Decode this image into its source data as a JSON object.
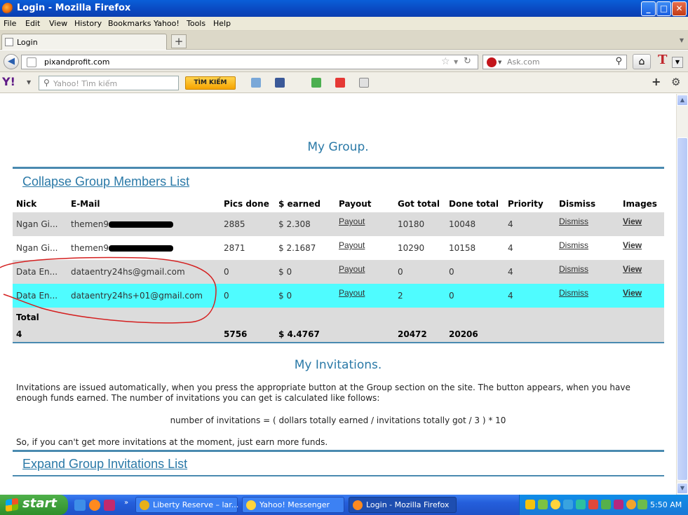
{
  "window": {
    "title": "Login - Mozilla Firefox",
    "buttons": {
      "minimize": "_",
      "maximize": "□",
      "close": "✕"
    }
  },
  "menu": [
    "File",
    "Edit",
    "View",
    "History",
    "Bookmarks",
    "Yahoo!",
    "Tools",
    "Help"
  ],
  "tab": {
    "label": "Login",
    "new_tab": "+"
  },
  "nav": {
    "url": "pixandprofit.com",
    "search_placeholder": "Ask.com",
    "back_icon": "back-arrow-icon",
    "home_icon": "home-icon"
  },
  "yahoo_toolbar": {
    "logo": "Y!",
    "search_placeholder": "Yahoo! Tìm kiếm",
    "search_button": "TÌM KIẾM"
  },
  "page": {
    "group_title": "My Group.",
    "collapse_link": "Collapse Group Members List",
    "columns": [
      "Nick",
      "E-Mail",
      "Pics done",
      "$ earned",
      "Payout",
      "Got total",
      "Done total",
      "Priority",
      "Dismiss",
      "Images"
    ],
    "rows": [
      {
        "nick": "Ngan Gi...",
        "email": "themen9",
        "pics": "2885",
        "earned": "$ 2.308",
        "payout": "Payout",
        "got": "10180",
        "done": "10048",
        "priority": "4",
        "dismiss": "Dismiss",
        "view": "View",
        "highlight": false
      },
      {
        "nick": "Ngan Gi...",
        "email": "themen9",
        "pics": "2871",
        "earned": "$ 2.1687",
        "payout": "Payout",
        "got": "10290",
        "done": "10158",
        "priority": "4",
        "dismiss": "Dismiss",
        "view": "View",
        "highlight": false
      },
      {
        "nick": "Data En...",
        "email": "dataentry24hs@gmail.com",
        "pics": "0",
        "earned": "$ 0",
        "payout": "Payout",
        "got": "0",
        "done": "0",
        "priority": "4",
        "dismiss": "Dismiss",
        "view": "View",
        "highlight": false
      },
      {
        "nick": "Data En...",
        "email": "dataentry24hs+01@gmail.com",
        "pics": "0",
        "earned": "$ 0",
        "payout": "Payout",
        "got": "2",
        "done": "0",
        "priority": "4",
        "dismiss": "Dismiss",
        "view": "View",
        "highlight": true
      }
    ],
    "total": {
      "label": "Total",
      "count": "4",
      "pics": "5756",
      "earned": "$ 4.4767",
      "got": "20472",
      "done": "20206"
    },
    "invitations_title": "My Invitations.",
    "invitations_text": "Invitations are issued automatically, when you press the appropriate button at the Group section on the site. The button appears, when you have enough funds earned. The number of invitations you can get is calculated like follows:",
    "formula": "number of invitations = ( dollars totally earned / invitations totally got / 3 ) * 10",
    "invitations_note": "So, if you can't get more invitations at the moment, just earn more funds.",
    "expand_link": "Expand Group Invitations List"
  },
  "taskbar": {
    "start": "start",
    "tasks": [
      {
        "label": "Liberty Reserve – lar...",
        "active": false
      },
      {
        "label": "Yahoo! Messenger",
        "active": false
      },
      {
        "label": "Login - Mozilla Firefox",
        "active": true
      }
    ],
    "more": "»",
    "clock": "5:50 AM"
  },
  "colors": {
    "link": "#2a79a7",
    "row_alt": "#dcdcdc",
    "row_highlight": "#4ffcff",
    "table_border": "#4a8ab0",
    "annotation": "#d42020"
  }
}
